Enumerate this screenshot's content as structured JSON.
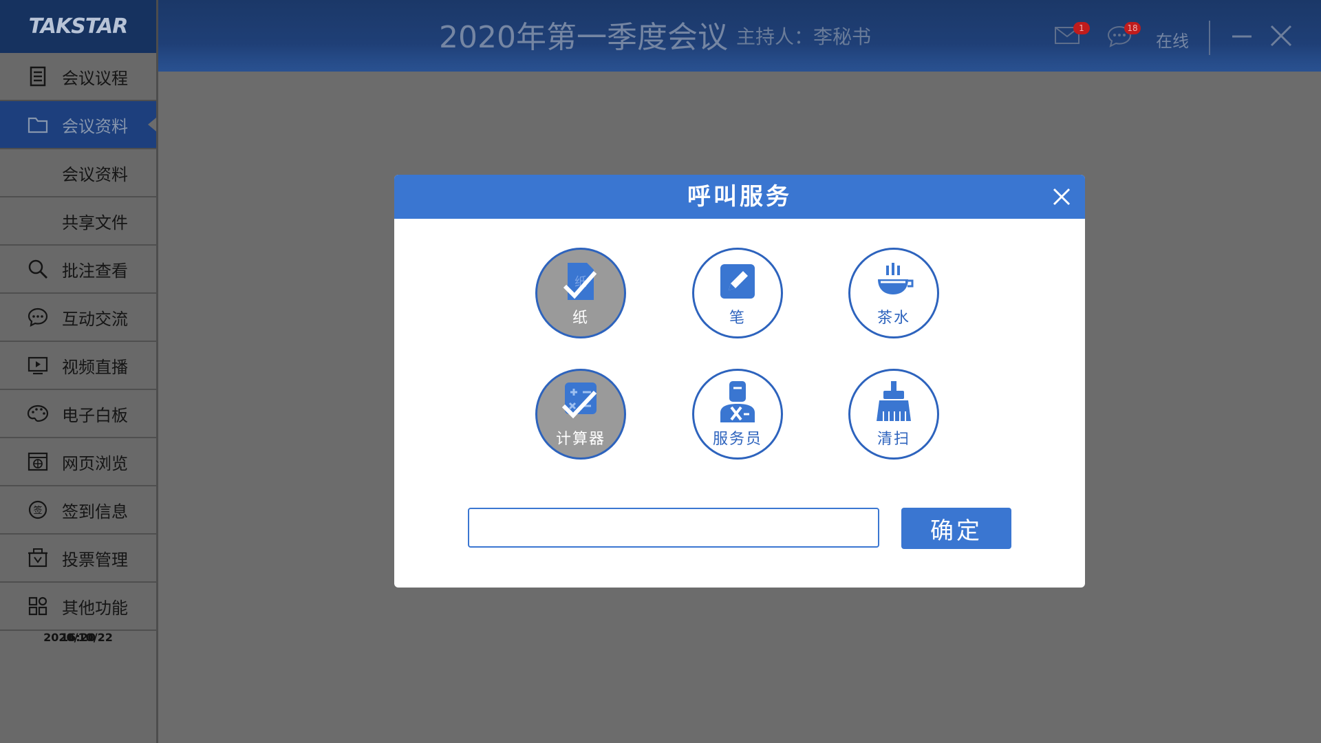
{
  "brand": {
    "logo_text": "TAKSTAR"
  },
  "header": {
    "title": "2020年第一季度会议",
    "host": "主持人：李秘书",
    "mail_count": "1",
    "message_count": "18",
    "status": "在线"
  },
  "sidebar": {
    "items": [
      {
        "label": "会议议程",
        "icon": "agenda-icon"
      },
      {
        "label": "会议资料",
        "icon": "folder-icon",
        "active": true
      },
      {
        "label": "会议资料",
        "sub": true
      },
      {
        "label": "共享文件",
        "sub": true
      },
      {
        "label": "批注查看",
        "icon": "search-icon"
      },
      {
        "label": "互动交流",
        "icon": "chat-icon"
      },
      {
        "label": "视频直播",
        "icon": "video-icon"
      },
      {
        "label": "电子白板",
        "icon": "palette-icon"
      },
      {
        "label": "网页浏览",
        "icon": "browser-icon"
      },
      {
        "label": "签到信息",
        "icon": "sign-in-icon"
      },
      {
        "label": "投票管理",
        "icon": "vote-icon"
      },
      {
        "label": "其他功能",
        "icon": "apps-icon"
      }
    ],
    "time": "16:20",
    "date": "2020/10/22"
  },
  "modal": {
    "title": "呼叫服务",
    "services": [
      {
        "label": "纸",
        "icon": "paper-icon",
        "selected": true
      },
      {
        "label": "笔",
        "icon": "pen-icon",
        "selected": false
      },
      {
        "label": "茶水",
        "icon": "tea-icon",
        "selected": false
      },
      {
        "label": "计算器",
        "icon": "calculator-icon",
        "selected": true
      },
      {
        "label": "服务员",
        "icon": "waiter-icon",
        "selected": false
      },
      {
        "label": "清扫",
        "icon": "broom-icon",
        "selected": false
      }
    ],
    "input_value": "",
    "confirm_label": "确定"
  },
  "colors": {
    "accent": "#3a76d1",
    "header": "#1f3f76",
    "active_nav": "#1d3f7d"
  }
}
